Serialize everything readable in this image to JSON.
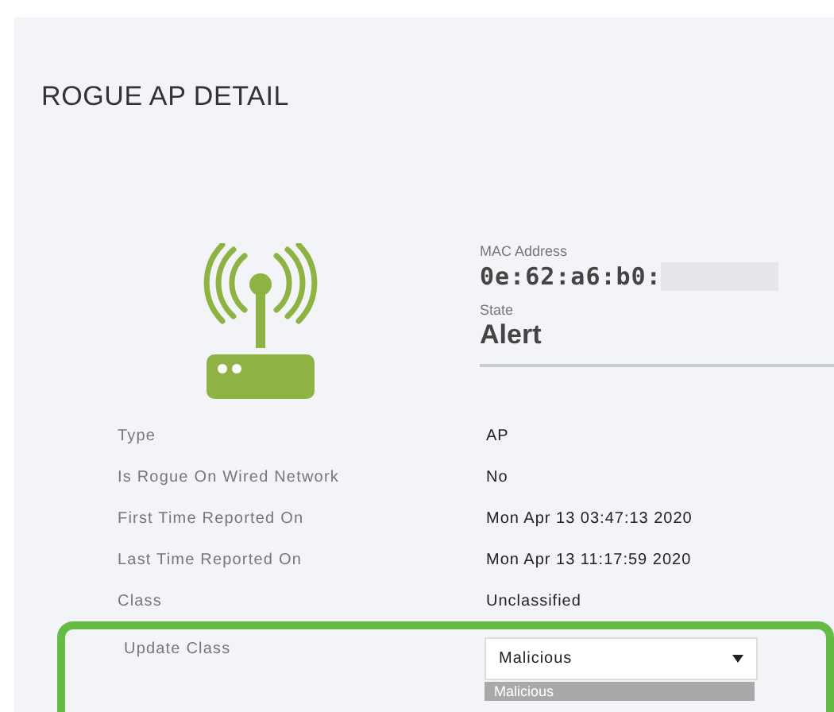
{
  "title": "ROGUE AP DETAIL",
  "summary": [
    {
      "label": "MAC Address",
      "value": "0e:62:a6:b0:",
      "kind": "mono",
      "redacted": true
    },
    {
      "label": "State",
      "value": "Alert",
      "kind": "plain"
    }
  ],
  "details": [
    {
      "label": "Type",
      "value": "AP"
    },
    {
      "label": "Is Rogue On Wired Network",
      "value": "No"
    },
    {
      "label": "First Time Reported On",
      "value": "Mon Apr 13 03:47:13 2020"
    },
    {
      "label": "Last Time Reported On",
      "value": "Mon Apr 13 11:17:59 2020"
    },
    {
      "label": "Class",
      "value": "Unclassified"
    }
  ],
  "update_class": {
    "label": "Update Class",
    "value": "Malicious",
    "highlighted": true,
    "options": [
      {
        "label": "Malicious",
        "selected": true
      }
    ]
  }
}
